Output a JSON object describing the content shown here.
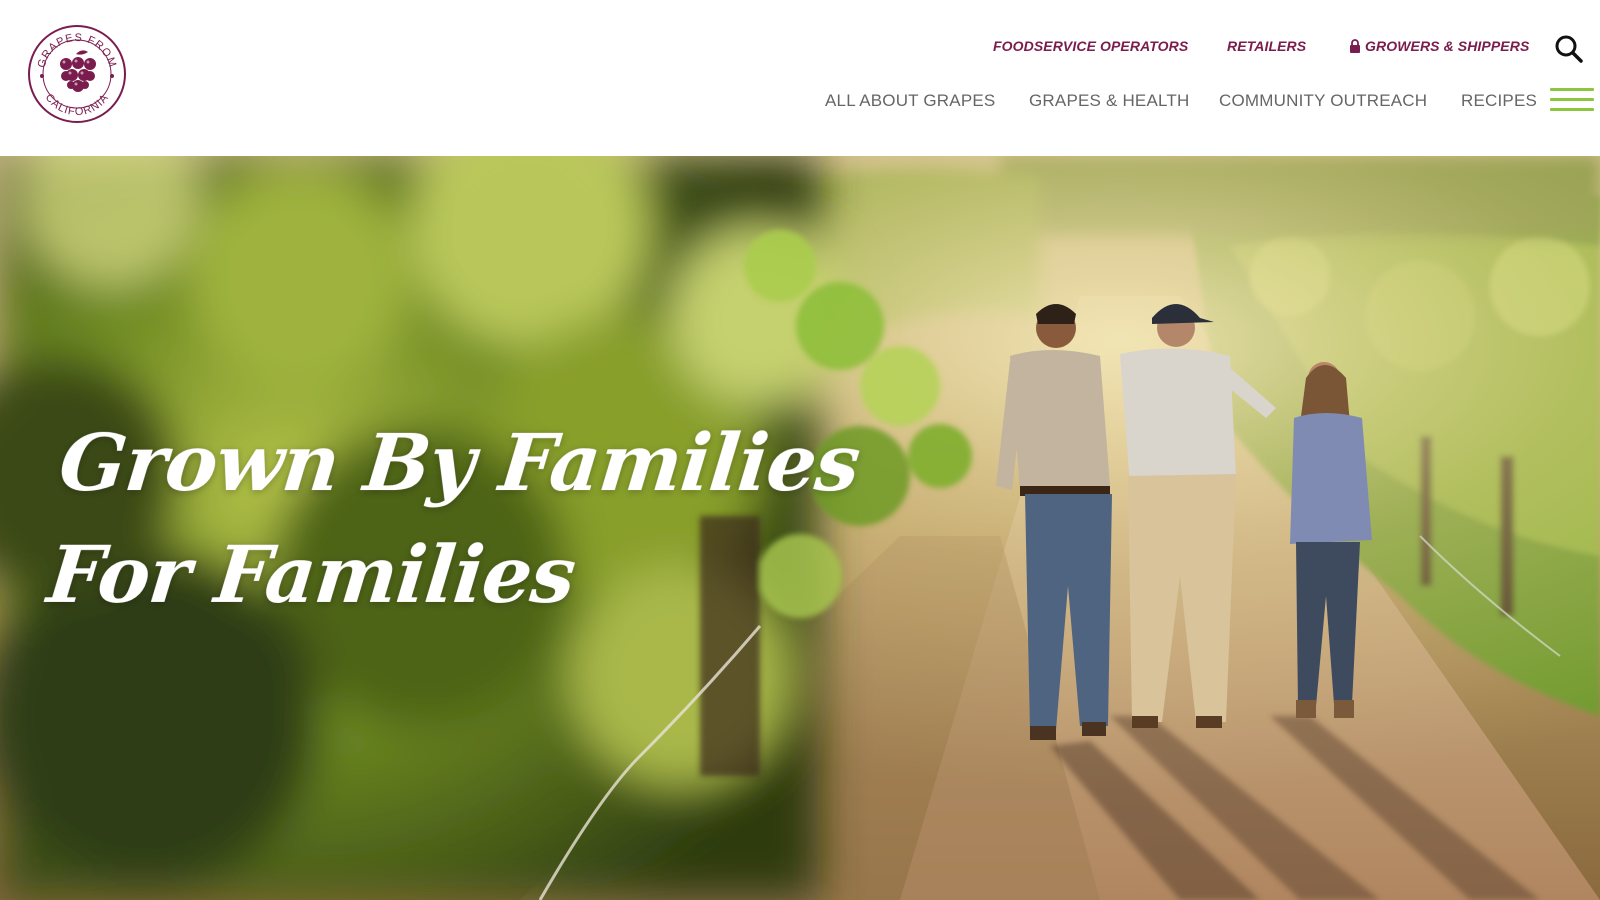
{
  "brand": {
    "logo_name": "Grapes from California",
    "logo_text_top": "GRAPES FROM",
    "logo_text_bottom": "CALIFORNIA",
    "color": "#7a1c4d"
  },
  "utility_nav": {
    "items": [
      {
        "label": "FOODSERVICE OPERATORS"
      },
      {
        "label": "RETAILERS"
      },
      {
        "label": "GROWERS & SHIPPERS",
        "icon": "lock-icon"
      }
    ],
    "color": "#7a1c4d"
  },
  "search": {
    "icon": "search-icon"
  },
  "main_nav": {
    "items": [
      {
        "label": "ALL ABOUT GRAPES"
      },
      {
        "label": "GRAPES & HEALTH"
      },
      {
        "label": "COMMUNITY OUTREACH"
      },
      {
        "label": "RECIPES"
      }
    ],
    "color": "#666666",
    "menu_icon": "hamburger-menu-icon",
    "menu_color": "#8cc63f"
  },
  "hero": {
    "title_line1": "Grown By Families",
    "title_line2": "For Families"
  }
}
